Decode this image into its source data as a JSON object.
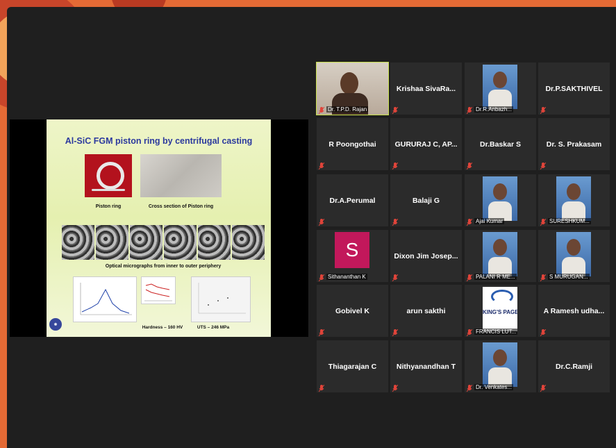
{
  "slide": {
    "title": "Al-SiC FGM piston ring by centrifugal casting",
    "cap_piston": "Piston ring",
    "cap_cross": "Cross section of Piston ring",
    "cap_micro": "Optical micrographs from inner to outer periphery",
    "cap_hardness": "Hardness – 160 HV",
    "cap_uts": "UTS – 246 MPa"
  },
  "participants": [
    {
      "name": "Dr. T.P.D. Rajan",
      "type": "video",
      "active": true
    },
    {
      "name": "Krishaa  SivaRa...",
      "type": "text"
    },
    {
      "name": "Dr.R.Anbazh...",
      "type": "photo"
    },
    {
      "name": "Dr.P.SAKTHIVEL",
      "type": "text"
    },
    {
      "name": "R Poongothai",
      "type": "text"
    },
    {
      "name": "GURURAJ C, AP...",
      "type": "text"
    },
    {
      "name": "Dr.Baskar S",
      "type": "text"
    },
    {
      "name": "Dr. S. Prakasam",
      "type": "text"
    },
    {
      "name": "Dr.A.Perumal",
      "type": "text"
    },
    {
      "name": "Balaji G",
      "type": "text"
    },
    {
      "name": "Ajai Kumar",
      "type": "photo"
    },
    {
      "name": "SURESHKUM...",
      "type": "photo"
    },
    {
      "name": "Sithananthan K",
      "type": "avatar",
      "letter": "S"
    },
    {
      "name": "Dixon Jim Josep...",
      "type": "text"
    },
    {
      "name": "PALANI R ME...",
      "type": "photo"
    },
    {
      "name": "S MURUGAN...",
      "type": "photo"
    },
    {
      "name": "Gobivel K",
      "type": "text"
    },
    {
      "name": "arun sakthi",
      "type": "text"
    },
    {
      "name": "FRANCIS LUT...",
      "type": "logo",
      "logo_text": "KING'S PAGE"
    },
    {
      "name": "A Ramesh udha...",
      "type": "text"
    },
    {
      "name": "Thiagarajan C",
      "type": "text"
    },
    {
      "name": "Nithyanandhan T",
      "type": "text"
    },
    {
      "name": "Dr. Venkates...",
      "type": "photo"
    },
    {
      "name": "Dr.C.Ramji",
      "type": "text"
    }
  ],
  "colors": {
    "active_border": "#c9e04c",
    "mic_muted": "#e0443a",
    "avatar_bg": "#c2185b"
  }
}
